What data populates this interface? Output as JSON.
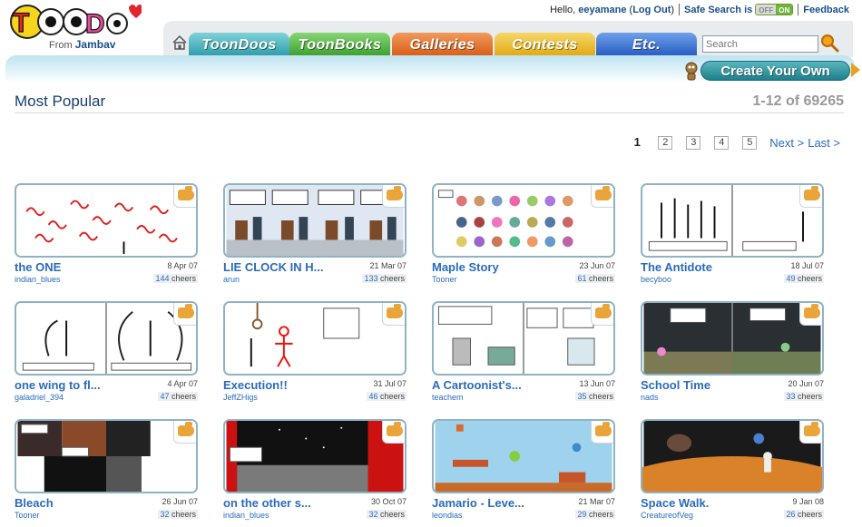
{
  "brand": {
    "logo_text": "ToonDoo",
    "from_label": "From",
    "from_name": "Jambav"
  },
  "userbar": {
    "hello": "Hello,",
    "username": "eeyamane",
    "logout": "Log Out",
    "safe_search": "Safe Search is",
    "toggle_off": "OFF",
    "toggle_on": "ON",
    "feedback": "Feedback"
  },
  "nav": {
    "tabs": [
      "ToonDoos",
      "ToonBooks",
      "Galleries",
      "Contests",
      "Etc."
    ],
    "search_placeholder": "Search"
  },
  "create_button": "Create Your Own",
  "section": {
    "title": "Most Popular",
    "count": "1-12 of 69265"
  },
  "pager": {
    "current": "1",
    "pages": [
      "2",
      "3",
      "4",
      "5"
    ],
    "next": "Next >",
    "last": "Last >"
  },
  "toons": [
    {
      "title": "the ONE",
      "date": "8 Apr 07",
      "author": "indian_blues",
      "cheers": "144",
      "cheers_label": "cheers"
    },
    {
      "title": "LIE CLOCK IN H...",
      "date": "21 Mar 07",
      "author": "arun",
      "cheers": "133",
      "cheers_label": "cheers"
    },
    {
      "title": "Maple Story",
      "date": "23 Jun 07",
      "author": "Tooner",
      "cheers": "61",
      "cheers_label": "cheers"
    },
    {
      "title": "The Antidote",
      "date": "18 Jul 07",
      "author": "becyboo",
      "cheers": "49",
      "cheers_label": "cheers"
    },
    {
      "title": "one wing to fl...",
      "date": "4 Apr 07",
      "author": "galadriel_394",
      "cheers": "47",
      "cheers_label": "cheers"
    },
    {
      "title": "Execution!!",
      "date": "31 Jul 07",
      "author": "JeffZHigs",
      "cheers": "46",
      "cheers_label": "cheers"
    },
    {
      "title": "A Cartoonist's...",
      "date": "13 Jun 07",
      "author": "teachem",
      "cheers": "35",
      "cheers_label": "cheers"
    },
    {
      "title": "School Time",
      "date": "20 Jun 07",
      "author": "nads",
      "cheers": "33",
      "cheers_label": "cheers"
    },
    {
      "title": "Bleach",
      "date": "26 Jun 07",
      "author": "Tooner",
      "cheers": "32",
      "cheers_label": "cheers"
    },
    {
      "title": "on the other s...",
      "date": "30 Oct 07",
      "author": "indian_blues",
      "cheers": "32",
      "cheers_label": "cheers"
    },
    {
      "title": "Jamario - Leve...",
      "date": "21 Mar 07",
      "author": "leondias",
      "cheers": "29",
      "cheers_label": "cheers"
    },
    {
      "title": "Space Walk.",
      "date": "9 Jan 08",
      "author": "CreatureofVeg",
      "cheers": "26",
      "cheers_label": "cheers"
    }
  ],
  "colors": {
    "link": "#2a6bbf",
    "heading": "#1a3e6e",
    "thumb_border": "#8fb3c5"
  }
}
